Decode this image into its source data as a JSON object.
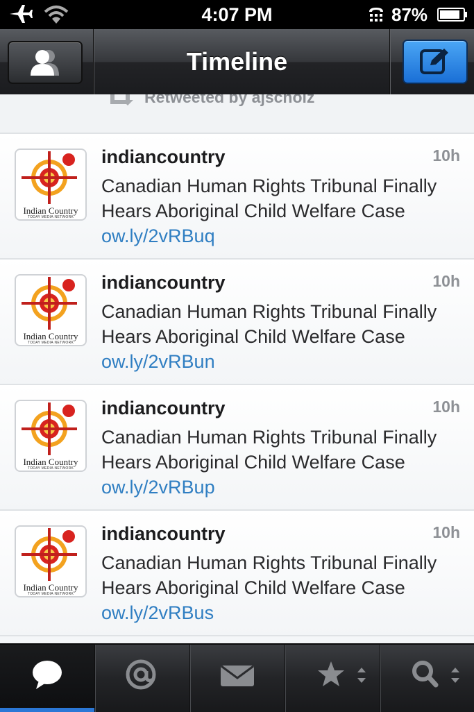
{
  "status_bar": {
    "time": "4:07 PM",
    "battery_percent": "87%"
  },
  "nav": {
    "title": "Timeline"
  },
  "retweet": {
    "text": "Retweeted by ajscholz"
  },
  "tweets": [
    {
      "user": "indiancountry",
      "time": "10h",
      "text": "Canadian Human Rights Tribunal Finally Hears Aboriginal Child Welfare Case ",
      "link": "ow.ly/2vRBuq"
    },
    {
      "user": "indiancountry",
      "time": "10h",
      "text": "Canadian Human Rights Tribunal Finally Hears Aboriginal Child Welfare Case ",
      "link": "ow.ly/2vRBun"
    },
    {
      "user": "indiancountry",
      "time": "10h",
      "text": "Canadian Human Rights Tribunal Finally Hears Aboriginal Child Welfare Case ",
      "link": "ow.ly/2vRBup"
    },
    {
      "user": "indiancountry",
      "time": "10h",
      "text": "Canadian Human Rights Tribunal Finally Hears Aboriginal Child Welfare Case ",
      "link": "ow.ly/2vRBus"
    }
  ],
  "avatar_logo": {
    "name": "Indian Country",
    "sub": "TODAY MEDIA NETWORK"
  },
  "tab_bar": {
    "tabs": [
      {
        "icon": "speech-bubble-icon",
        "active": true
      },
      {
        "icon": "at-sign-icon",
        "active": false
      },
      {
        "icon": "envelope-icon",
        "active": false
      },
      {
        "icon": "star-icon",
        "active": false
      },
      {
        "icon": "search-icon",
        "active": false
      }
    ]
  },
  "colors": {
    "link": "#2f7ec2",
    "compose_button": "#1a6fd6",
    "active_tab": "#2b77d6"
  }
}
